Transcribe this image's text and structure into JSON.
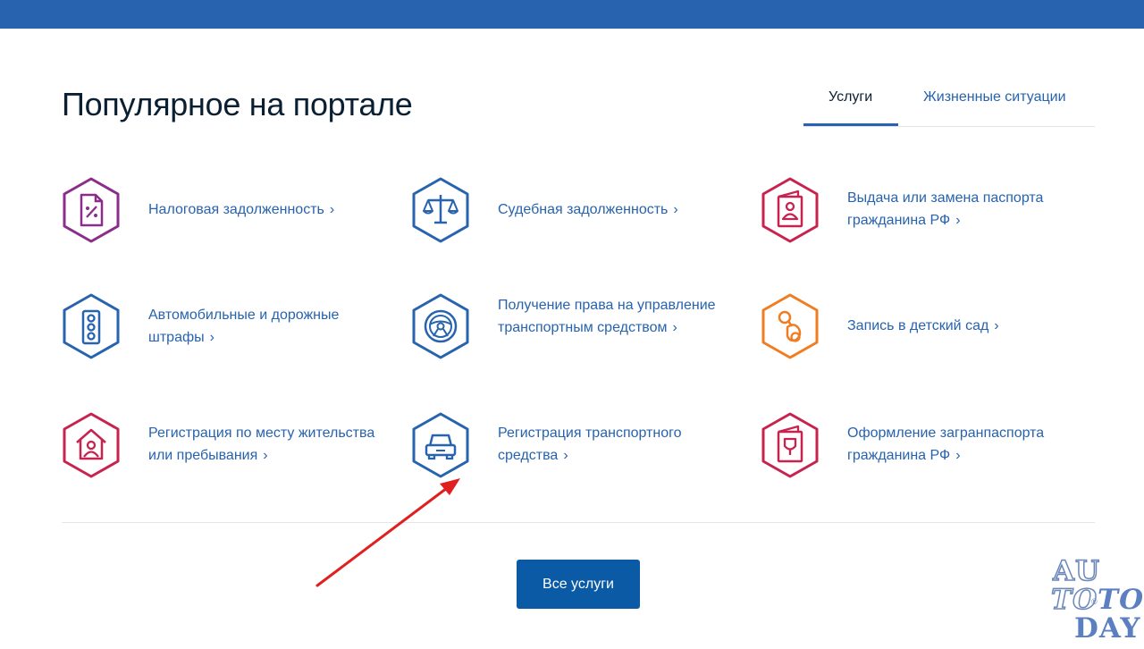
{
  "header": {
    "bar_color": "#2763ae"
  },
  "page_title": "Популярное на портале",
  "tabs": [
    {
      "label": "Услуги",
      "active": true
    },
    {
      "label": "Жизненные ситуации",
      "active": false
    }
  ],
  "services": [
    {
      "label": "Налоговая задолженность",
      "icon": "tax-document-icon",
      "color": "#8b2d8b"
    },
    {
      "label": "Судебная задолженность",
      "icon": "scales-icon",
      "color": "#2763ae"
    },
    {
      "label": "Выдача или замена паспорта гражданина РФ",
      "icon": "passport-icon",
      "color": "#c8234e"
    },
    {
      "label": "Автомобильные и дорожные штрафы",
      "icon": "traffic-light-icon",
      "color": "#2763ae"
    },
    {
      "label": "Получение права на управление транспортным средством",
      "icon": "steering-wheel-icon",
      "color": "#2763ae"
    },
    {
      "label": "Запись в детский сад",
      "icon": "pacifier-icon",
      "color": "#f07d21"
    },
    {
      "label": "Регистрация по месту жительства или пребывания",
      "icon": "house-person-icon",
      "color": "#c8234e"
    },
    {
      "label": "Регистрация транспортного средства",
      "icon": "car-icon",
      "color": "#2763ae"
    },
    {
      "label": "Оформление загранпаспорта гражданина РФ",
      "icon": "foreign-passport-icon",
      "color": "#c8234e"
    }
  ],
  "chevron": "›",
  "all_services_button": "Все услуги",
  "accent_colors": {
    "primary": "#2763ae",
    "button": "#0b5aa6",
    "arrow": "#e02020"
  },
  "watermark": {
    "line1": "AU",
    "line2a": "TO",
    "line2b": "TO",
    "line3": "DAY"
  }
}
